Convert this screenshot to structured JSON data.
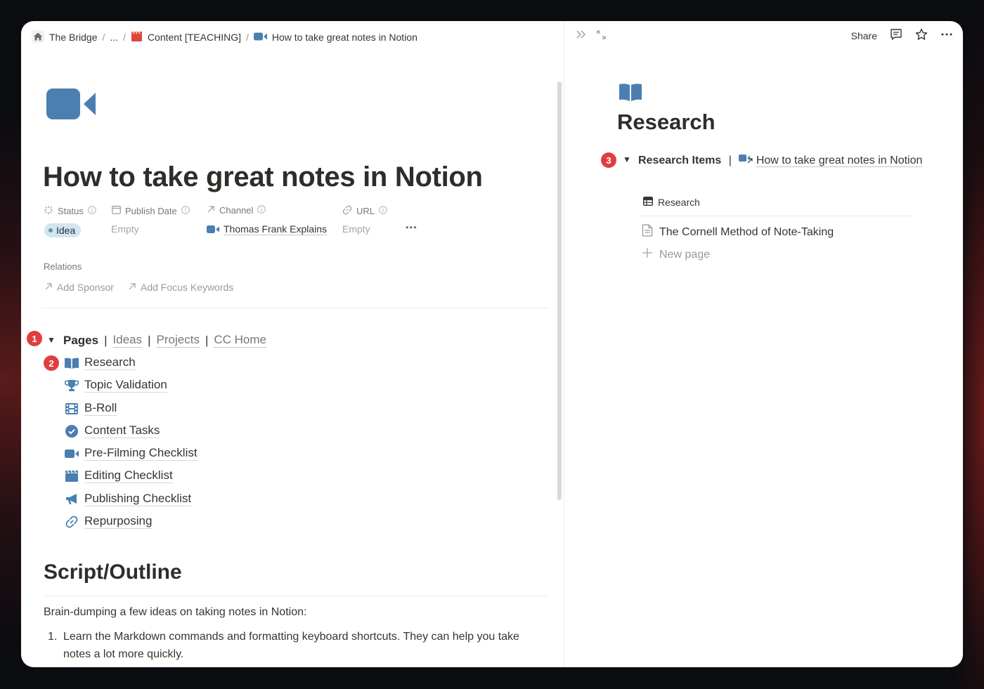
{
  "breadcrumb": {
    "workspace": "The Bridge",
    "ellipsis": "...",
    "parent": "Content [TEACHING]",
    "current": "How to take great notes in Notion",
    "separator": "/"
  },
  "page": {
    "title": "How to take great notes in Notion",
    "icon": "video-camera-icon"
  },
  "properties": {
    "status": {
      "label": "Status",
      "value": "Idea"
    },
    "publish_date": {
      "label": "Publish Date",
      "value": "Empty"
    },
    "channel": {
      "label": "Channel",
      "value": "Thomas Frank Explains"
    },
    "url": {
      "label": "URL",
      "value": "Empty"
    },
    "more": "•••"
  },
  "relations": {
    "label": "Relations",
    "add_sponsor": "Add Sponsor",
    "add_focus_keywords": "Add Focus Keywords"
  },
  "badges": {
    "one": "1",
    "two": "2",
    "three": "3"
  },
  "pages_toggle": {
    "title": "Pages",
    "separator": "|",
    "links": [
      "Ideas",
      "Projects",
      "CC Home"
    ]
  },
  "pages": [
    {
      "label": "Research",
      "icon": "book-icon"
    },
    {
      "label": "Topic Validation",
      "icon": "trophy-icon"
    },
    {
      "label": "B-Roll",
      "icon": "film-icon"
    },
    {
      "label": "Content Tasks",
      "icon": "check-circle-icon"
    },
    {
      "label": "Pre-Filming Checklist",
      "icon": "video-camera-icon"
    },
    {
      "label": "Editing Checklist",
      "icon": "clapperboard-icon"
    },
    {
      "label": "Publishing Checklist",
      "icon": "megaphone-icon"
    },
    {
      "label": "Repurposing",
      "icon": "link-icon"
    }
  ],
  "script": {
    "heading": "Script/Outline",
    "intro": "Brain-dumping a few ideas on taking notes in Notion:",
    "items": [
      {
        "num": "1.",
        "text": "Learn the Markdown commands and formatting keyboard shortcuts. They can help you take notes a lot more quickly."
      }
    ]
  },
  "side_peek": {
    "share": "Share",
    "title": "Research",
    "research_items_label": "Research Items",
    "separator": "|",
    "linked_page": "How to take great notes in Notion",
    "view_tab": "Research",
    "rows": [
      "The Cornell Method of Note-Taking"
    ],
    "new_page": "New page"
  },
  "colors": {
    "accent_blue": "#4a7fb0",
    "badge_red": "#e03e3e",
    "notion_red": "#e0453a"
  }
}
